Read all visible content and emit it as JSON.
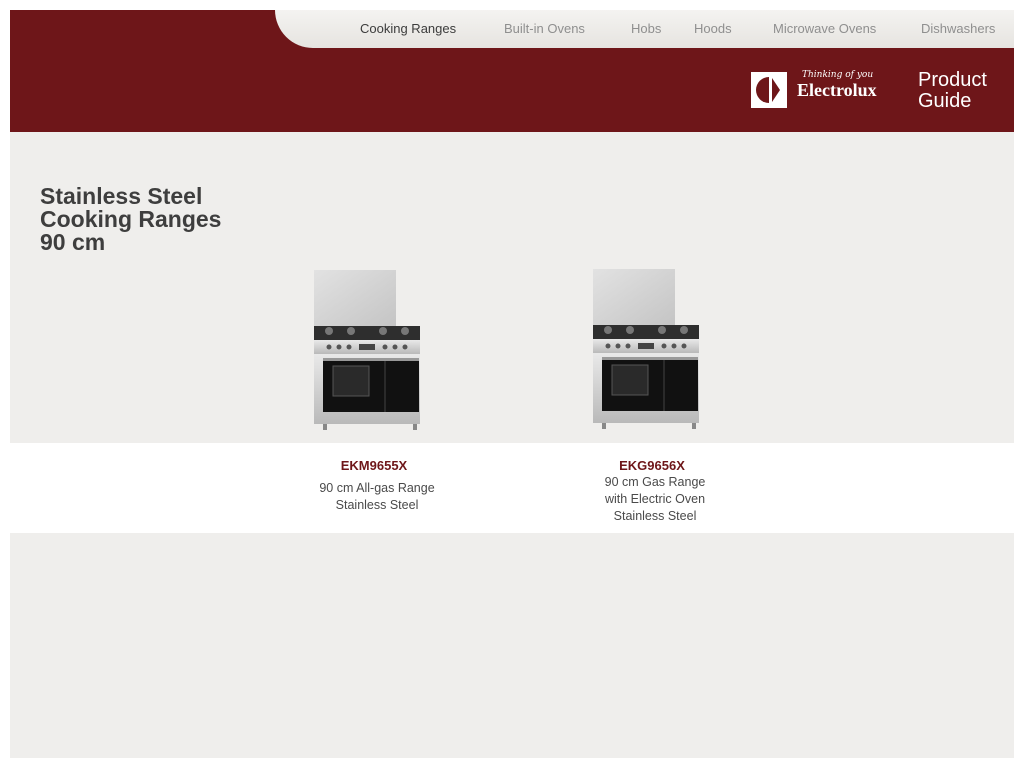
{
  "nav": {
    "items": [
      {
        "label": "Cooking Ranges",
        "active": true
      },
      {
        "label": "Built-in Ovens",
        "active": false
      },
      {
        "label": "Hobs",
        "active": false
      },
      {
        "label": "Hoods",
        "active": false
      },
      {
        "label": "Microwave Ovens",
        "active": false
      },
      {
        "label": "Dishwashers",
        "active": false
      }
    ]
  },
  "brand": {
    "tagline": "Thinking of you",
    "name": "Electrolux",
    "guide_line1": "Product",
    "guide_line2": "Guide",
    "logo_icon": "electrolux-logo-icon"
  },
  "page": {
    "title_lines": [
      "Stainless Steel",
      "Cooking Ranges",
      "90 cm"
    ]
  },
  "products": [
    {
      "model": "EKM9655X",
      "desc_lines": [
        "90 cm All-gas Range",
        "Stainless Steel"
      ],
      "image_icon": "cooking-range-image"
    },
    {
      "model": "EKG9656X",
      "desc_lines": [
        "90 cm Gas Range",
        "with Electric Oven",
        "Stainless Steel"
      ],
      "image_icon": "cooking-range-image"
    }
  ],
  "colors": {
    "brand": "#6e1619",
    "nav_bg": "#efeeec",
    "nav_active": "#3c3c3c",
    "nav_inactive": "#8f8f8f",
    "panel_bg": "#efeeec"
  }
}
